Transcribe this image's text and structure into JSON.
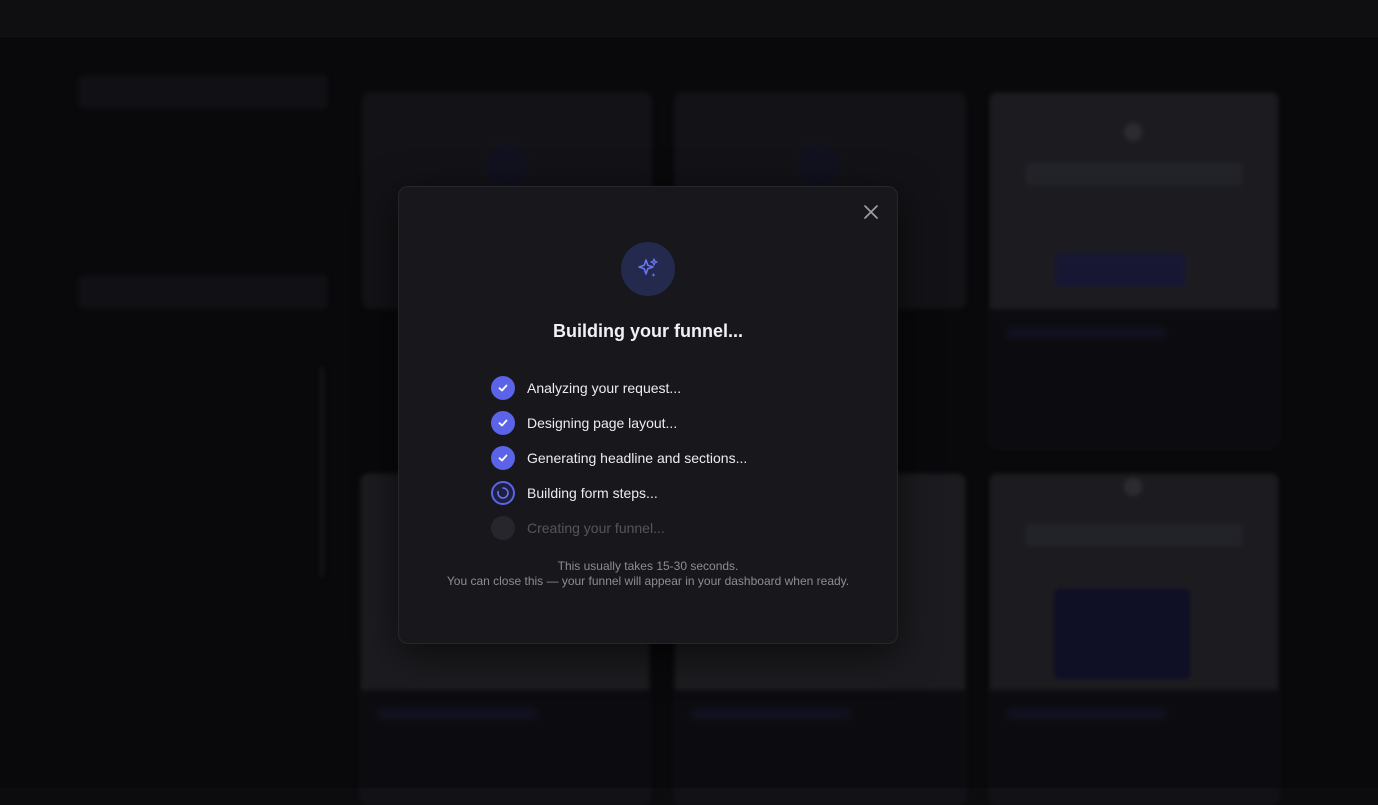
{
  "modal": {
    "title": "Building your funnel...",
    "steps": [
      {
        "label": "Analyzing your request...",
        "status": "done"
      },
      {
        "label": "Designing page layout...",
        "status": "done"
      },
      {
        "label": "Generating headline and sections...",
        "status": "done"
      },
      {
        "label": "Building form steps...",
        "status": "in-progress"
      },
      {
        "label": "Creating your funnel...",
        "status": "pending"
      }
    ],
    "note_line1": "This usually takes 15-30 seconds.",
    "note_line2": "You can close this — your funnel will appear in your dashboard when ready.",
    "hero_icon": "sparkles-icon",
    "close_icon": "close-icon"
  },
  "colors": {
    "accent": "#5b63e8",
    "modal_bg": "#18181c",
    "page_bg": "#0c0c0f"
  }
}
